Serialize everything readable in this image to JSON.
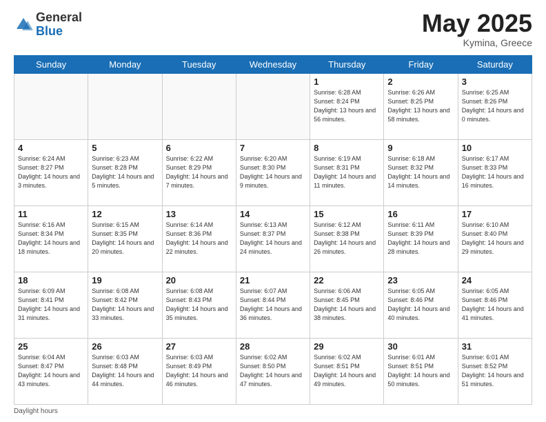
{
  "header": {
    "logo_general": "General",
    "logo_blue": "Blue",
    "month_title": "May 2025",
    "location": "Kymina, Greece"
  },
  "days_of_week": [
    "Sunday",
    "Monday",
    "Tuesday",
    "Wednesday",
    "Thursday",
    "Friday",
    "Saturday"
  ],
  "footer": {
    "note": "Daylight hours"
  },
  "weeks": [
    [
      {
        "day": "",
        "empty": true
      },
      {
        "day": "",
        "empty": true
      },
      {
        "day": "",
        "empty": true
      },
      {
        "day": "",
        "empty": true
      },
      {
        "day": "1",
        "sunrise": "Sunrise: 6:28 AM",
        "sunset": "Sunset: 8:24 PM",
        "daylight": "Daylight: 13 hours and 56 minutes."
      },
      {
        "day": "2",
        "sunrise": "Sunrise: 6:26 AM",
        "sunset": "Sunset: 8:25 PM",
        "daylight": "Daylight: 13 hours and 58 minutes."
      },
      {
        "day": "3",
        "sunrise": "Sunrise: 6:25 AM",
        "sunset": "Sunset: 8:26 PM",
        "daylight": "Daylight: 14 hours and 0 minutes."
      }
    ],
    [
      {
        "day": "4",
        "sunrise": "Sunrise: 6:24 AM",
        "sunset": "Sunset: 8:27 PM",
        "daylight": "Daylight: 14 hours and 3 minutes."
      },
      {
        "day": "5",
        "sunrise": "Sunrise: 6:23 AM",
        "sunset": "Sunset: 8:28 PM",
        "daylight": "Daylight: 14 hours and 5 minutes."
      },
      {
        "day": "6",
        "sunrise": "Sunrise: 6:22 AM",
        "sunset": "Sunset: 8:29 PM",
        "daylight": "Daylight: 14 hours and 7 minutes."
      },
      {
        "day": "7",
        "sunrise": "Sunrise: 6:20 AM",
        "sunset": "Sunset: 8:30 PM",
        "daylight": "Daylight: 14 hours and 9 minutes."
      },
      {
        "day": "8",
        "sunrise": "Sunrise: 6:19 AM",
        "sunset": "Sunset: 8:31 PM",
        "daylight": "Daylight: 14 hours and 11 minutes."
      },
      {
        "day": "9",
        "sunrise": "Sunrise: 6:18 AM",
        "sunset": "Sunset: 8:32 PM",
        "daylight": "Daylight: 14 hours and 14 minutes."
      },
      {
        "day": "10",
        "sunrise": "Sunrise: 6:17 AM",
        "sunset": "Sunset: 8:33 PM",
        "daylight": "Daylight: 14 hours and 16 minutes."
      }
    ],
    [
      {
        "day": "11",
        "sunrise": "Sunrise: 6:16 AM",
        "sunset": "Sunset: 8:34 PM",
        "daylight": "Daylight: 14 hours and 18 minutes."
      },
      {
        "day": "12",
        "sunrise": "Sunrise: 6:15 AM",
        "sunset": "Sunset: 8:35 PM",
        "daylight": "Daylight: 14 hours and 20 minutes."
      },
      {
        "day": "13",
        "sunrise": "Sunrise: 6:14 AM",
        "sunset": "Sunset: 8:36 PM",
        "daylight": "Daylight: 14 hours and 22 minutes."
      },
      {
        "day": "14",
        "sunrise": "Sunrise: 6:13 AM",
        "sunset": "Sunset: 8:37 PM",
        "daylight": "Daylight: 14 hours and 24 minutes."
      },
      {
        "day": "15",
        "sunrise": "Sunrise: 6:12 AM",
        "sunset": "Sunset: 8:38 PM",
        "daylight": "Daylight: 14 hours and 26 minutes."
      },
      {
        "day": "16",
        "sunrise": "Sunrise: 6:11 AM",
        "sunset": "Sunset: 8:39 PM",
        "daylight": "Daylight: 14 hours and 28 minutes."
      },
      {
        "day": "17",
        "sunrise": "Sunrise: 6:10 AM",
        "sunset": "Sunset: 8:40 PM",
        "daylight": "Daylight: 14 hours and 29 minutes."
      }
    ],
    [
      {
        "day": "18",
        "sunrise": "Sunrise: 6:09 AM",
        "sunset": "Sunset: 8:41 PM",
        "daylight": "Daylight: 14 hours and 31 minutes."
      },
      {
        "day": "19",
        "sunrise": "Sunrise: 6:08 AM",
        "sunset": "Sunset: 8:42 PM",
        "daylight": "Daylight: 14 hours and 33 minutes."
      },
      {
        "day": "20",
        "sunrise": "Sunrise: 6:08 AM",
        "sunset": "Sunset: 8:43 PM",
        "daylight": "Daylight: 14 hours and 35 minutes."
      },
      {
        "day": "21",
        "sunrise": "Sunrise: 6:07 AM",
        "sunset": "Sunset: 8:44 PM",
        "daylight": "Daylight: 14 hours and 36 minutes."
      },
      {
        "day": "22",
        "sunrise": "Sunrise: 6:06 AM",
        "sunset": "Sunset: 8:45 PM",
        "daylight": "Daylight: 14 hours and 38 minutes."
      },
      {
        "day": "23",
        "sunrise": "Sunrise: 6:05 AM",
        "sunset": "Sunset: 8:46 PM",
        "daylight": "Daylight: 14 hours and 40 minutes."
      },
      {
        "day": "24",
        "sunrise": "Sunrise: 6:05 AM",
        "sunset": "Sunset: 8:46 PM",
        "daylight": "Daylight: 14 hours and 41 minutes."
      }
    ],
    [
      {
        "day": "25",
        "sunrise": "Sunrise: 6:04 AM",
        "sunset": "Sunset: 8:47 PM",
        "daylight": "Daylight: 14 hours and 43 minutes."
      },
      {
        "day": "26",
        "sunrise": "Sunrise: 6:03 AM",
        "sunset": "Sunset: 8:48 PM",
        "daylight": "Daylight: 14 hours and 44 minutes."
      },
      {
        "day": "27",
        "sunrise": "Sunrise: 6:03 AM",
        "sunset": "Sunset: 8:49 PM",
        "daylight": "Daylight: 14 hours and 46 minutes."
      },
      {
        "day": "28",
        "sunrise": "Sunrise: 6:02 AM",
        "sunset": "Sunset: 8:50 PM",
        "daylight": "Daylight: 14 hours and 47 minutes."
      },
      {
        "day": "29",
        "sunrise": "Sunrise: 6:02 AM",
        "sunset": "Sunset: 8:51 PM",
        "daylight": "Daylight: 14 hours and 49 minutes."
      },
      {
        "day": "30",
        "sunrise": "Sunrise: 6:01 AM",
        "sunset": "Sunset: 8:51 PM",
        "daylight": "Daylight: 14 hours and 50 minutes."
      },
      {
        "day": "31",
        "sunrise": "Sunrise: 6:01 AM",
        "sunset": "Sunset: 8:52 PM",
        "daylight": "Daylight: 14 hours and 51 minutes."
      }
    ]
  ]
}
